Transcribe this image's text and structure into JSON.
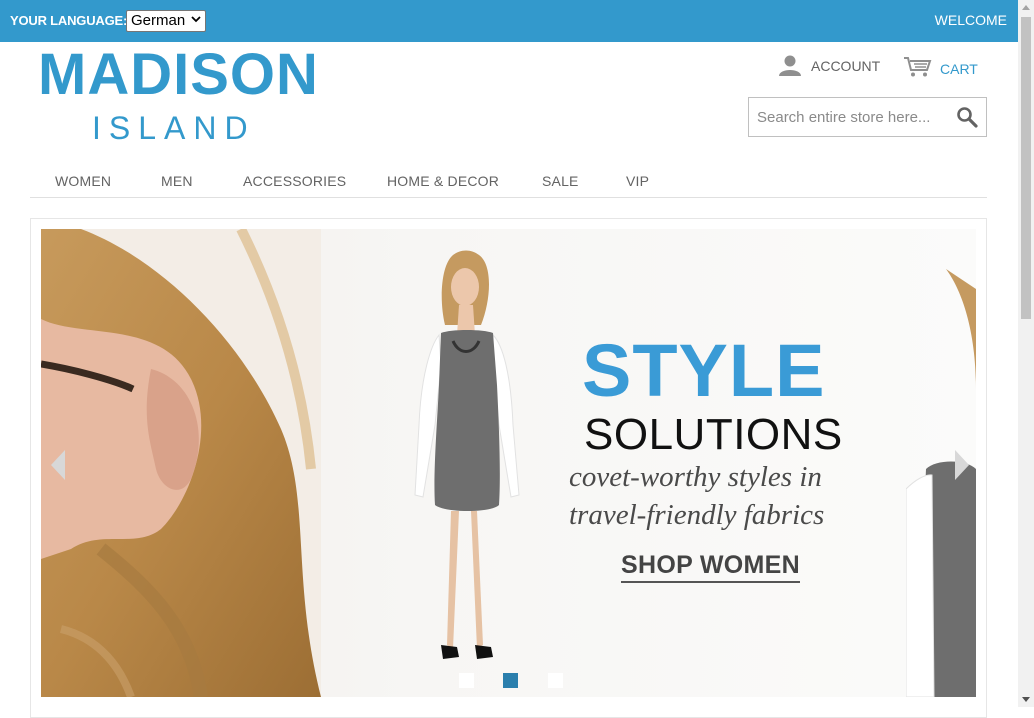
{
  "header": {
    "language_label": "YOUR LANGUAGE:",
    "language_selected": "German",
    "welcome": "WELCOME",
    "logo_main": "MADISON",
    "logo_sub": "ISLAND",
    "account_label": "ACCOUNT",
    "cart_label": "CART",
    "search_placeholder": "Search entire store here..."
  },
  "nav": {
    "items": [
      "WOMEN",
      "MEN",
      "ACCESSORIES",
      "HOME & DECOR",
      "SALE",
      "VIP"
    ]
  },
  "slider": {
    "headline": "STYLE",
    "subheadline": "SOLUTIONS",
    "tagline_1": "covet-worthy styles in",
    "tagline_2": "travel-friendly fabrics",
    "cta": "SHOP WOMEN",
    "slide_count": 3,
    "active_index": 1
  },
  "colors": {
    "brand": "#3399cc",
    "headline": "#3a9bd6",
    "active_dot": "#2b7fad"
  },
  "icons": [
    "account-icon",
    "cart-icon",
    "search-icon",
    "chevron-down-icon",
    "arrow-left-icon",
    "arrow-right-icon"
  ]
}
